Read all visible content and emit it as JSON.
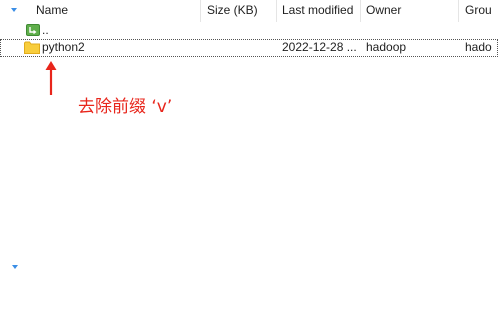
{
  "columns": {
    "name": "Name",
    "size": "Size (KB)",
    "modified": "Last modified",
    "owner": "Owner",
    "group": "Grou"
  },
  "rows": [
    {
      "name": "..",
      "size": "",
      "modified": "",
      "owner": "",
      "group": "",
      "icon": "parent-folder-icon"
    },
    {
      "name": "python2",
      "size": "",
      "modified": "2022-12-28 ...",
      "owner": "hadoop",
      "group": "hado",
      "icon": "folder-icon"
    }
  ],
  "annotation": {
    "text": "去除前缀 ‘v’",
    "color": "#e8251b"
  },
  "colors": {
    "accent": "#3a8ee6",
    "folder": "#f8cd3c",
    "parent_folder": "#5fae4b"
  }
}
